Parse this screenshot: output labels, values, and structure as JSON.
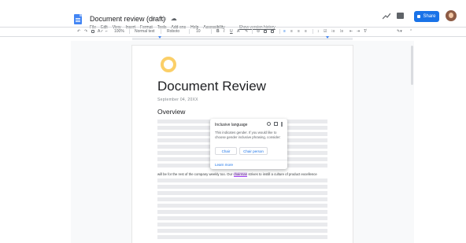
{
  "header": {
    "doc_title": "Document review (draft)",
    "share_label": "Share",
    "menu": [
      "File",
      "Edit",
      "View",
      "Insert",
      "Format",
      "Tools",
      "Add-ons",
      "Help",
      "Accessibility"
    ],
    "version_history": "Show version history"
  },
  "toolbar": {
    "zoom": "100%",
    "style": "Normal text",
    "font": "Roboto",
    "size": "10",
    "bold": "B",
    "italic": "I",
    "underline": "U",
    "text_color": "A"
  },
  "document": {
    "title": "Document Review",
    "date": "September 04, 20XX",
    "heading": "Overview",
    "sentence_before": "will be for the rest of the company weekly too. Our ",
    "flagged_word": "chairman",
    "sentence_after": " strives to instill a culture of product excellence"
  },
  "popup": {
    "title": "Inclusive language",
    "body": "This indicates gender. If you would like to choose gender inclusive phrasing, consider:",
    "suggestions": [
      "Chair",
      "Chair person"
    ],
    "learn_more": "Learn more"
  },
  "colors": {
    "accent": "#1a73e8",
    "highlight": "#e8d7f5",
    "logo": "#fbcf68"
  }
}
